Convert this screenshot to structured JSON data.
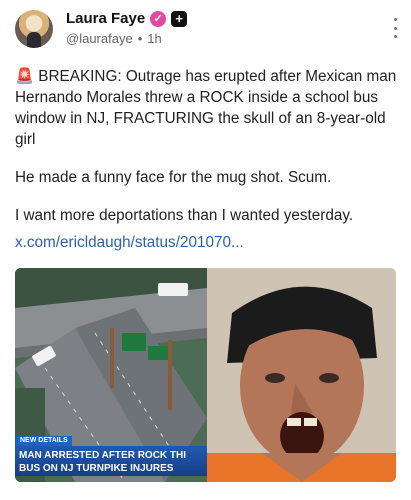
{
  "post": {
    "author_name": "Laura Faye",
    "handle": "@laurafaye",
    "dot": "•",
    "time": "1h",
    "paragraphs": [
      "🚨 BREAKING: Outrage has erupted after Mexican man Hernando Morales threw a ROCK inside a school bus window in NJ, FRACTURING the skull of an 8-year-old girl",
      "He made a funny face for the mug shot. Scum.",
      "I want more deportations than I wanted yesterday."
    ],
    "link_text": "x.com/ericldaugh/status/201070..."
  },
  "media": {
    "news_tag": "NEW DETAILS",
    "headline_line1": "MAN ARRESTED AFTER ROCK THI",
    "headline_line2": "BUS ON NJ TURNPIKE INJURES"
  },
  "colors": {
    "link": "#2c5fb7",
    "verified_badge": "#e24aa0",
    "news_bar": "#1e5ab1"
  },
  "icons": [
    "verified-icon",
    "plus-icon",
    "more-options-icon"
  ]
}
